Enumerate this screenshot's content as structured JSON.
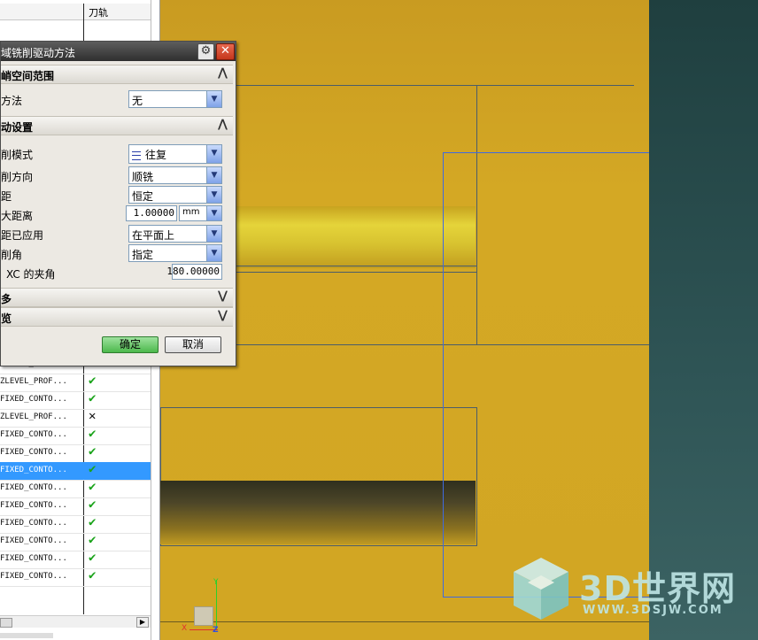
{
  "navigator": {
    "column_header": "刀轨",
    "rows": [
      {
        "name": "ZLEVEL_PROF...",
        "status": "ok"
      },
      {
        "name": "ZLEVEL_PROF...",
        "status": "ok"
      },
      {
        "name": "FIXED_CONTO...",
        "status": "ok"
      },
      {
        "name": "ZLEVEL_PROF...",
        "status": "bad"
      },
      {
        "name": "FIXED_CONTO...",
        "status": "ok"
      },
      {
        "name": "FIXED_CONTO...",
        "status": "ok"
      },
      {
        "name": "FIXED_CONTO...",
        "status": "ok",
        "selected": true
      },
      {
        "name": "FIXED_CONTO...",
        "status": "ok"
      },
      {
        "name": "FIXED_CONTO...",
        "status": "ok"
      },
      {
        "name": "FIXED_CONTO...",
        "status": "ok"
      },
      {
        "name": "FIXED_CONTO...",
        "status": "ok"
      },
      {
        "name": "FIXED_CONTO...",
        "status": "ok"
      },
      {
        "name": "FIXED_CONTO...",
        "status": "ok"
      }
    ],
    "status_glyphs": {
      "ok": "✔",
      "bad": "✕"
    }
  },
  "dialog": {
    "title": "域铣削驱动方法",
    "gear_glyph": "⚙",
    "close_glyph": "✕",
    "section_steep": {
      "label": "峭空间范围",
      "chevron": "⋀"
    },
    "method_label": "方法",
    "method_value": "无",
    "section_drive": {
      "label": "动设置",
      "chevron": "⋀"
    },
    "cut_mode_label": "削模式",
    "cut_mode_value": "往复",
    "cut_dir_label": "削方向",
    "cut_dir_value": "顺铣",
    "stepover_label": "距",
    "stepover_value": "恒定",
    "max_dist_label": "大距离",
    "max_dist_value": "1.00000",
    "max_dist_unit": "mm",
    "applied_label": "距已应用",
    "applied_value": "在平面上",
    "cut_angle_label": "削角",
    "cut_angle_value": "指定",
    "xc_angle_label": "XC 的夹角",
    "xc_angle_value": "180.00000",
    "section_more": {
      "label": "多",
      "chevron": "⋁"
    },
    "section_preview": {
      "label": "览",
      "chevron": "⋁"
    },
    "ok_label": "确定",
    "cancel_label": "取消",
    "dropdown_glyph": "▼"
  },
  "viewport": {
    "triad": {
      "y": "Y",
      "x": "X",
      "z": "Z"
    }
  },
  "watermark": {
    "text": "3D世界网",
    "url": "WWW.3DSJW.COM"
  }
}
